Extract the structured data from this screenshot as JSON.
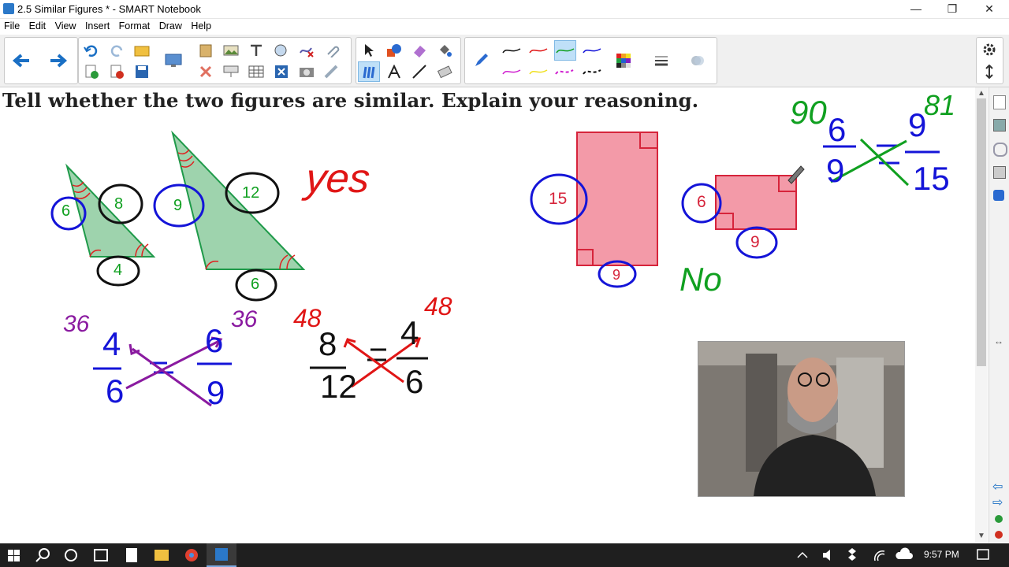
{
  "window": {
    "title": "2.5 Similar Figures * - SMART Notebook",
    "minimize_glyph": "—",
    "restore_glyph": "❐",
    "close_glyph": "✕"
  },
  "menu": [
    "File",
    "Edit",
    "View",
    "Insert",
    "Format",
    "Draw",
    "Help"
  ],
  "page": {
    "heading": "Tell whether the two figures are similar. Explain your reasoning."
  },
  "annotations": {
    "tri1_short": "6",
    "tri1_long": "8",
    "tri1_base": "4",
    "tri2_short": "9",
    "tri2_long": "12",
    "tri2_base": "6",
    "tri_answer": "yes",
    "cross1_tl": "4",
    "cross1_bl": "6",
    "cross1_tr": "6",
    "cross1_br": "9",
    "cross1_prod_left": "36",
    "cross1_prod_right": "36",
    "cross2_tl": "8",
    "cross2_bl": "12",
    "cross2_tr": "4",
    "cross2_br": "6",
    "cross2_prod_left": "48",
    "cross2_prod_right": "48",
    "rect1_height": "15",
    "rect1_width": "9",
    "rect2_height": "6",
    "rect2_width": "9",
    "rect_answer": "No",
    "frac_tl": "6",
    "frac_bl": "9",
    "frac_tr": "9",
    "frac_br": "15",
    "frac_prod_left": "90",
    "frac_prod_right": "81"
  },
  "taskbar": {
    "clock": "9:57 PM"
  },
  "colors": {
    "triangle_fill": "#9ed3ad",
    "triangle_stroke": "#1f9a4a",
    "rect_fill": "#f39aa8",
    "rect_stroke": "#d6243b",
    "ink_blue": "#1414d8",
    "ink_black": "#111111",
    "ink_red": "#e01616",
    "ink_green": "#10a020",
    "ink_purple": "#8a1aa0",
    "toolbar_bg": "#f0f0f0",
    "taskbar_bg": "#1f1f1f"
  }
}
